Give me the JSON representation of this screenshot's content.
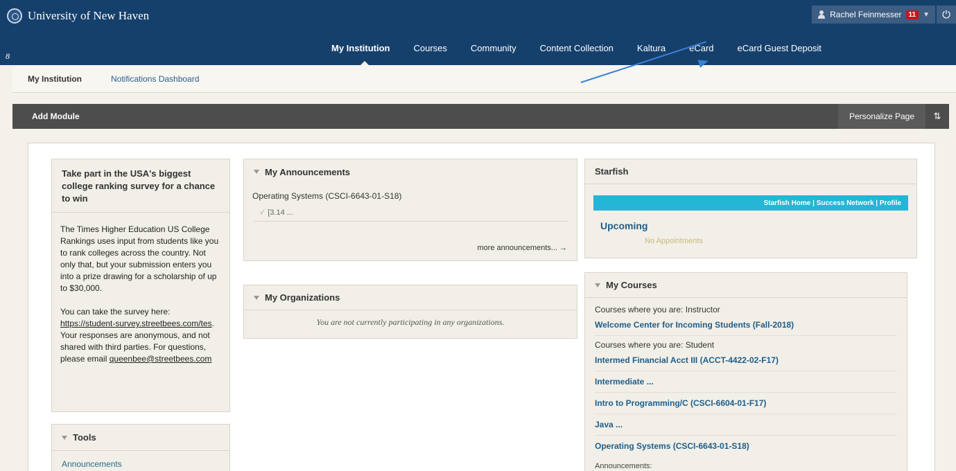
{
  "header": {
    "institution": "University of New Haven",
    "user_name": "Rachel Feinmesser",
    "notification_count": "11",
    "edit_mark": "8",
    "nav": [
      {
        "label": "My Institution",
        "active": true
      },
      {
        "label": "Courses"
      },
      {
        "label": "Community"
      },
      {
        "label": "Content Collection"
      },
      {
        "label": "Kaltura"
      },
      {
        "label": "eCard"
      },
      {
        "label": "eCard Guest Deposit"
      }
    ]
  },
  "subnav": {
    "title": "My Institution",
    "link": "Notifications Dashboard"
  },
  "module_bar": {
    "add_module": "Add Module",
    "personalize": "Personalize Page",
    "reorder_icon": "⇅"
  },
  "promo": {
    "heading": "Take part in the USA's biggest college ranking survey for a chance to win",
    "para1": "The Times Higher Education US College Rankings uses input from students like you to rank colleges across the country. Not only that, but your submission enters you into a prize drawing for a scholarship of up to $30,000.",
    "para2_prefix": "You can take the survey here: ",
    "survey_link": "https://student-survey.streetbees.com/tes",
    "para2_suffix": ". Your responses are anonymous, and not shared with third parties. For questions, please email ",
    "email_link": "queenbee@streetbees.com"
  },
  "tools": {
    "title": "Tools",
    "link": "Announcements"
  },
  "announcements": {
    "title": "My Announcements",
    "course": "Operating Systems (CSCI-6643-01-S18)",
    "item": "[3.14 ...",
    "more": "more announcements... →"
  },
  "organizations": {
    "title": "My Organizations",
    "empty": "You are not currently participating in any organizations."
  },
  "starfish": {
    "title": "Starfish",
    "bar_links": "Starfish Home | Success Network | Profile",
    "upcoming": "Upcoming",
    "none": "No Appointments"
  },
  "courses": {
    "title": "My Courses",
    "instructor_label": "Courses where you are: Instructor",
    "instructor_courses": [
      "Welcome Center for Incoming Students (Fall-2018)"
    ],
    "student_label": "Courses where you are: Student",
    "student_courses": [
      "Intermed Financial Acct III (ACCT-4422-02-F17)",
      "Intermediate ...",
      "Intro to Programming/C (CSCI-6604-01-F17)",
      "Java ...",
      "Operating Systems (CSCI-6643-01-S18)"
    ],
    "announcements_label": "Announcements:"
  }
}
